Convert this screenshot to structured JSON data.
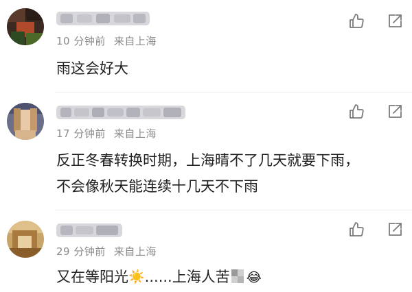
{
  "comments": [
    {
      "time": "10 分钟前",
      "source": "来自上海",
      "text": "雨这会好大"
    },
    {
      "time": "17 分钟前",
      "source": "来自上海",
      "lines": [
        "反正冬春转换时期，上海晴不了几天就要下雨，",
        "不会像秋天能连续十几天不下雨"
      ]
    },
    {
      "time": "29 分钟前",
      "source": "来自上海",
      "text_a": "又在等阳光",
      "text_b": "......上海人苦",
      "emoji_sun": "☀️",
      "emoji_laugh": "😂"
    }
  ],
  "icons": {
    "like": "thumbs-up-icon",
    "share": "share-icon"
  },
  "colors": {
    "meta_text": "#8a8a8a",
    "body_text": "#222222",
    "icon": "#7a7a7a"
  }
}
